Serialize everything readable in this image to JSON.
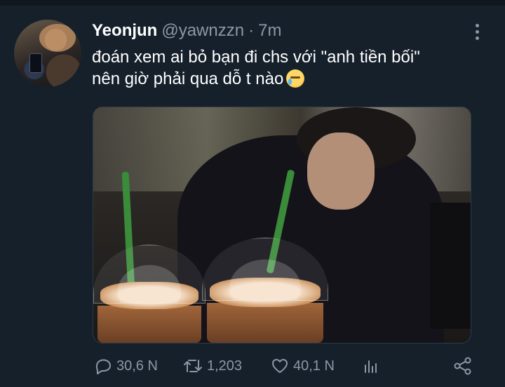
{
  "tweet": {
    "author_name": "Yeonjun",
    "author_handle": "@yawnzzn",
    "separator": "·",
    "time": "7m",
    "text_lines": [
      "đoán xem ai bỏ bạn đi chs với \"anh tiền bối\"",
      "nên giờ phải qua dỗ t nào"
    ],
    "emoji": "crying-face-emoji"
  },
  "actions": {
    "replies": "30,6 N",
    "retweets": "1,203",
    "likes": "40,1 N"
  },
  "icons": {
    "more": "more-vertical-icon",
    "reply": "reply-icon",
    "retweet": "retweet-icon",
    "like": "heart-icon",
    "analytics": "analytics-icon",
    "share": "share-icon"
  },
  "colors": {
    "background": "#15202b",
    "secondary_text": "#8b98a5",
    "primary_text": "#ffffff"
  }
}
